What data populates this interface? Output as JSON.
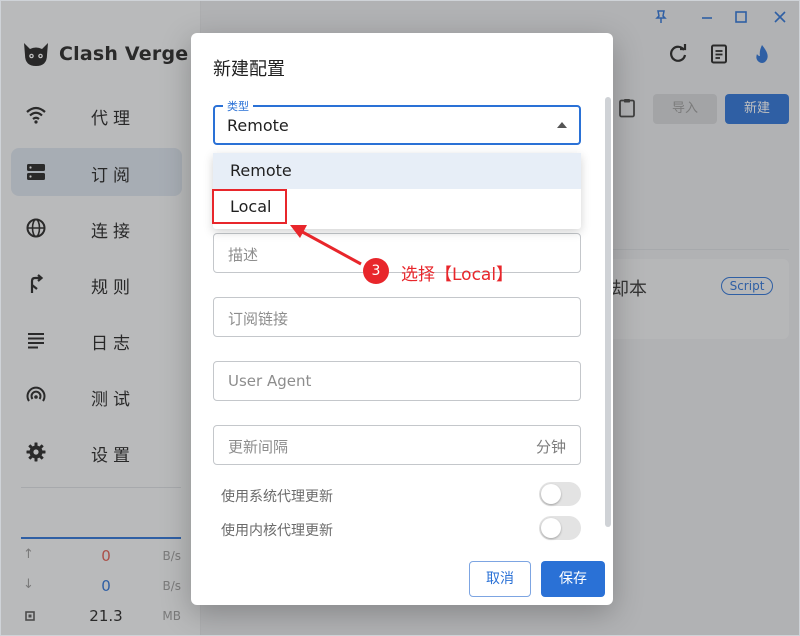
{
  "app": {
    "name": "Clash Verge"
  },
  "sidebar": {
    "items": [
      {
        "label": "代理",
        "icon": "wifi-icon"
      },
      {
        "label": "订阅",
        "icon": "server-icon",
        "active": true
      },
      {
        "label": "连接",
        "icon": "globe-icon"
      },
      {
        "label": "规则",
        "icon": "fork-icon"
      },
      {
        "label": "日志",
        "icon": "lines-icon"
      },
      {
        "label": "测试",
        "icon": "radar-icon"
      },
      {
        "label": "设置",
        "icon": "gear-icon"
      }
    ],
    "traffic": {
      "upload": {
        "value": "0",
        "unit": "B/s"
      },
      "download": {
        "value": "0",
        "unit": "B/s"
      },
      "memory": {
        "value": "21.3",
        "unit": "MB"
      }
    }
  },
  "toolbar": {
    "import_label": "导入",
    "new_label": "新建"
  },
  "profile_card": {
    "title_fragment": "却本",
    "badge": "Script"
  },
  "dialog": {
    "title": "新建配置",
    "type_field": {
      "legend": "类型",
      "value": "Remote",
      "options": [
        "Remote",
        "Local"
      ]
    },
    "fields": {
      "desc_placeholder": "描述",
      "url_placeholder": "订阅链接",
      "ua_placeholder": "User Agent",
      "interval_placeholder": "更新间隔",
      "interval_suffix": "分钟"
    },
    "toggles": {
      "system_proxy": "使用系统代理更新",
      "core_proxy": "使用内核代理更新"
    },
    "cancel_label": "取消",
    "save_label": "保存"
  },
  "annotation": {
    "step": "3",
    "text": "选择【Local】",
    "color": "#e8262b"
  },
  "colors": {
    "accent": "#2a71d6",
    "upload": "#e05a4f",
    "download": "#2a71d6"
  }
}
